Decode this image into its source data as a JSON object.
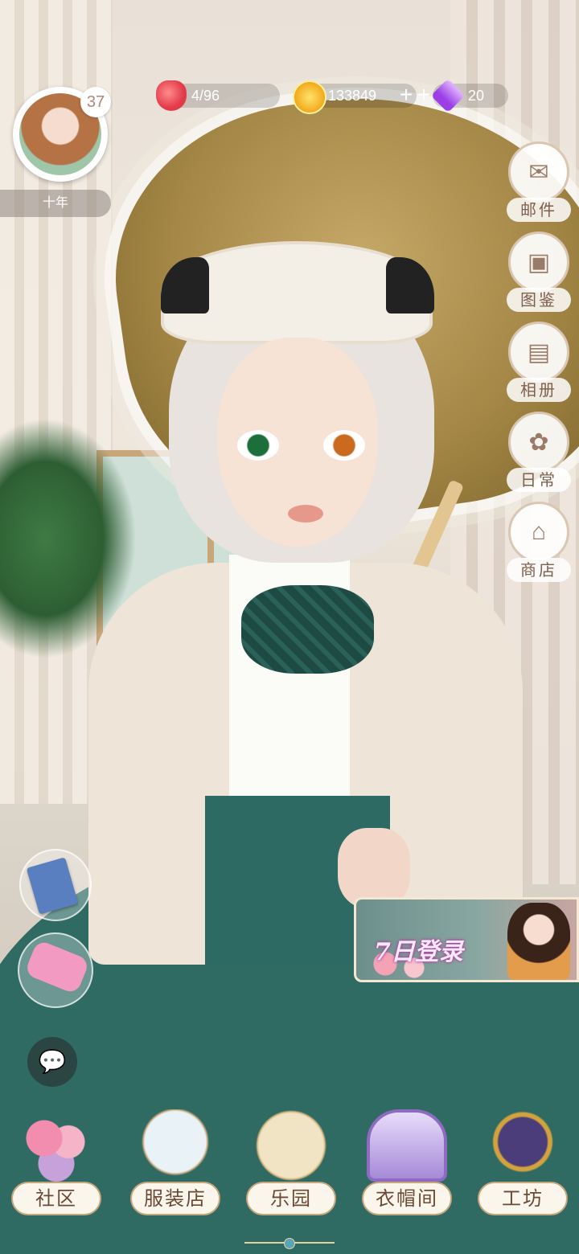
{
  "profile": {
    "level": "37",
    "name": "十年"
  },
  "resources": {
    "stamina": "4/96",
    "coins": "133849",
    "diamonds": "20",
    "plus": "+"
  },
  "side_menu": [
    {
      "label": "邮件",
      "icon": "mail-icon"
    },
    {
      "label": "图鉴",
      "icon": "collection-icon"
    },
    {
      "label": "相册",
      "icon": "album-icon"
    },
    {
      "label": "日常",
      "icon": "daily-icon"
    },
    {
      "label": "商店",
      "icon": "shop-icon"
    }
  ],
  "event_banner": {
    "title": "7日登录"
  },
  "chat_icon": "chat-icon",
  "bottom_nav": [
    {
      "label": "社区"
    },
    {
      "label": "服装店"
    },
    {
      "label": "乐园"
    },
    {
      "label": "衣帽间"
    },
    {
      "label": "工坊"
    }
  ],
  "colors": {
    "accent": "#c7a77c",
    "text_brown": "#6b4a35"
  }
}
